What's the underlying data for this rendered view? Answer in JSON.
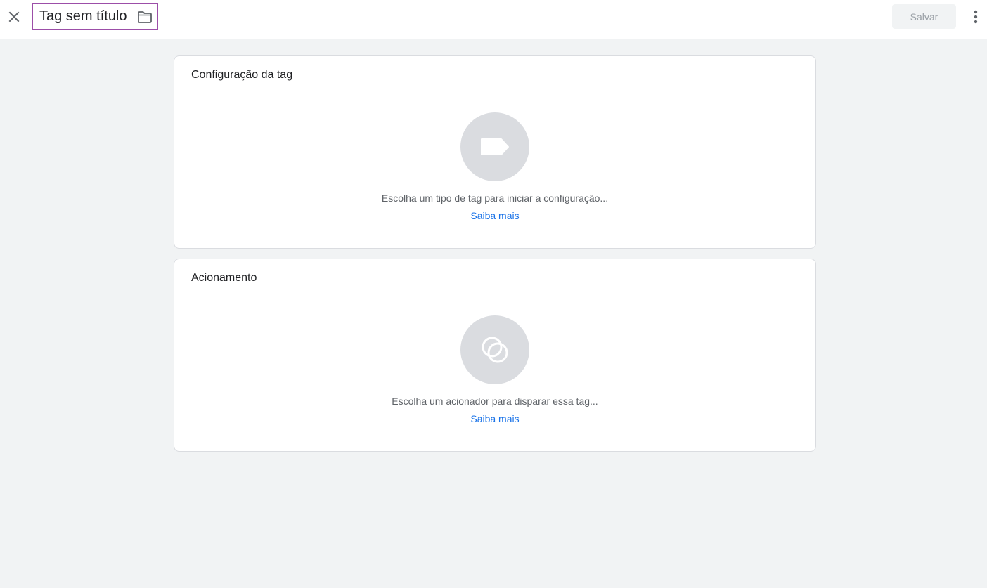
{
  "header": {
    "close_icon": "close-icon",
    "title": "Tag sem título",
    "folder_icon": "folder-icon",
    "save_label": "Salvar",
    "more_icon": "more-vert-icon"
  },
  "tag_config": {
    "title": "Configuração da tag",
    "icon": "tag-icon",
    "hint": "Escolha um tipo de tag para iniciar a configuração...",
    "link": "Saiba mais"
  },
  "trigger": {
    "title": "Acionamento",
    "icon": "trigger-circles-icon",
    "hint": "Escolha um acionador para disparar essa tag...",
    "link": "Saiba mais"
  },
  "colors": {
    "accent_link": "#1a73e8",
    "title_highlight": "#9c4ea8",
    "placeholder_circle": "#dadce0",
    "page_background": "#f1f3f4"
  }
}
